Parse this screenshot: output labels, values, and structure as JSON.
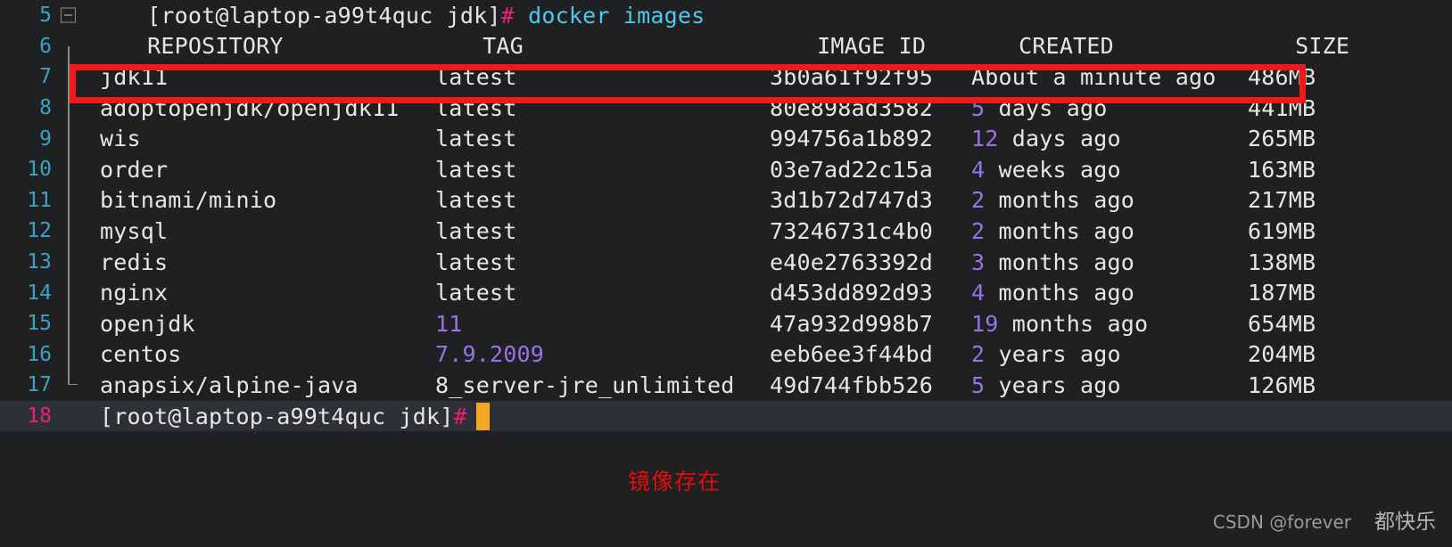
{
  "terminal": {
    "prompt": "[root@laptop-a99t4quc jdk]",
    "prompt_symbol": "#",
    "command": "docker images",
    "headers": {
      "repository": "REPOSITORY",
      "tag": "TAG",
      "image_id": "IMAGE ID",
      "created": "CREATED",
      "size": "SIZE"
    },
    "line_numbers": {
      "command": "5",
      "header": "6",
      "rows": [
        "7",
        "8",
        "9",
        "10",
        "11",
        "12",
        "13",
        "14",
        "15",
        "16",
        "17"
      ],
      "final_prompt": "18"
    },
    "rows": [
      {
        "repository": "jdk11",
        "tag": "latest",
        "tag_color": "white",
        "image_id": "3b0a61f92f95",
        "created_num": "",
        "created_rest": "About a minute ago",
        "size": "486MB"
      },
      {
        "repository": "adoptopenjdk/openjdk11",
        "tag": "latest",
        "tag_color": "white",
        "image_id": "80e898ad3582",
        "created_num": "5",
        "created_rest": " days ago",
        "size": "441MB"
      },
      {
        "repository": "wis",
        "tag": "latest",
        "tag_color": "white",
        "image_id": "994756a1b892",
        "created_num": "12",
        "created_rest": " days ago",
        "size": "265MB"
      },
      {
        "repository": "order",
        "tag": "latest",
        "tag_color": "white",
        "image_id": "03e7ad22c15a",
        "created_num": "4",
        "created_rest": " weeks ago",
        "size": "163MB"
      },
      {
        "repository": "bitnami/minio",
        "tag": "latest",
        "tag_color": "white",
        "image_id": "3d1b72d747d3",
        "created_num": "2",
        "created_rest": " months ago",
        "size": "217MB"
      },
      {
        "repository": "mysql",
        "tag": "latest",
        "tag_color": "white",
        "image_id": "73246731c4b0",
        "created_num": "2",
        "created_rest": " months ago",
        "size": "619MB"
      },
      {
        "repository": "redis",
        "tag": "latest",
        "tag_color": "white",
        "image_id": "e40e2763392d",
        "created_num": "3",
        "created_rest": " months ago",
        "size": "138MB"
      },
      {
        "repository": "nginx",
        "tag": "latest",
        "tag_color": "white",
        "image_id": "d453dd892d93",
        "created_num": "4",
        "created_rest": " months ago",
        "size": "187MB"
      },
      {
        "repository": "openjdk",
        "tag": "11",
        "tag_color": "purple",
        "image_id": "47a932d998b7",
        "created_num": "19",
        "created_rest": " months ago",
        "size": "654MB"
      },
      {
        "repository": "centos",
        "tag": "7.9.2009",
        "tag_color": "purple",
        "image_id": "eeb6ee3f44bd",
        "created_num": "2",
        "created_rest": " years ago",
        "size": "204MB"
      },
      {
        "repository": "anapsix/alpine-java",
        "tag": "8_server-jre_unlimited",
        "tag_color": "white",
        "image_id": "49d744fbb526",
        "created_num": "5",
        "created_rest": " years ago",
        "size": "126MB"
      }
    ]
  },
  "highlight": {
    "color": "#f11818",
    "target_row_repository": "jdk11"
  },
  "annotation": {
    "text": "镜像存在",
    "color": "#e60c0c"
  },
  "watermark": {
    "source": "CSDN @forever",
    "suffix": "都快乐"
  }
}
